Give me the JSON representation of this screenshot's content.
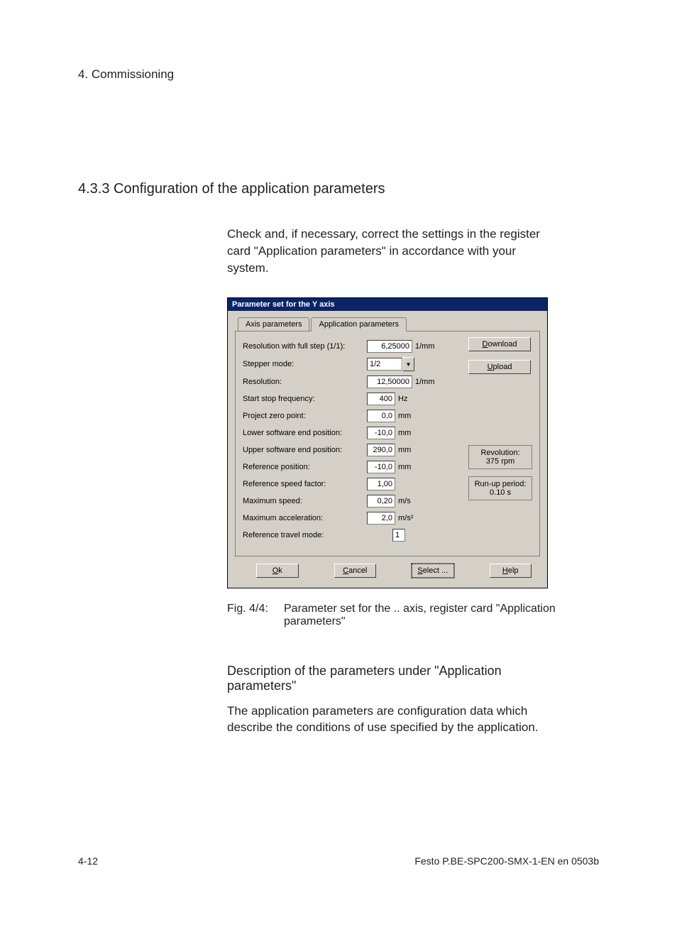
{
  "header": {
    "chapter": "4.  Commissioning"
  },
  "section_title": "4.3.3  Configuration of the application parameters",
  "intro": "Check and, if necessary, correct the settings in the register card \"Application parameters\" in accordance with your system.",
  "dialog": {
    "title": "Parameter set for the Y axis",
    "tabs": {
      "axis": "Axis parameters",
      "app": "Application parameters"
    },
    "fields": {
      "resolution_full_step": {
        "label": "Resolution with full step (1/1):",
        "value": "6,25000",
        "unit": "1/mm"
      },
      "stepper_mode": {
        "label": "Stepper mode:",
        "value": "1/2"
      },
      "resolution": {
        "label": "Resolution:",
        "value": "12,50000",
        "unit": "1/mm"
      },
      "start_stop_freq": {
        "label": "Start stop frequency:",
        "value": "400",
        "unit": "Hz"
      },
      "project_zero": {
        "label": "Project zero point:",
        "value": "0,0",
        "unit": "mm"
      },
      "lower_end": {
        "label": "Lower software end position:",
        "value": "-10,0",
        "unit": "mm"
      },
      "upper_end": {
        "label": "Upper software end position:",
        "value": "290,0",
        "unit": "mm"
      },
      "ref_position": {
        "label": "Reference position:",
        "value": "-10,0",
        "unit": "mm"
      },
      "ref_speed_factor": {
        "label": "Reference speed factor:",
        "value": "1,00",
        "unit": ""
      },
      "max_speed": {
        "label": "Maximum speed:",
        "value": "0,20",
        "unit": "m/s"
      },
      "max_accel": {
        "label": "Maximum acceleration:",
        "value": "2,0",
        "unit": "m/s²"
      },
      "ref_travel_mode": {
        "label": "Reference travel mode:",
        "value": "1"
      }
    },
    "side": {
      "download": "Download",
      "upload": "Upload",
      "revolution_label": "Revolution:",
      "revolution_value": "375 rpm",
      "runup_label": "Run-up period:",
      "runup_value": "0.10 s"
    },
    "buttons": {
      "ok": "Ok",
      "cancel": "Cancel",
      "select": "Select ...",
      "help": "Help"
    }
  },
  "caption": {
    "label": "Fig. 4/4:",
    "text": "Parameter set for the .. axis, register card \"Application parameters\""
  },
  "subheading": "Description of the parameters under \"Application parameters\"",
  "body": "The application parameters are configuration data which describe the conditions of use specified by the application.",
  "footer": {
    "page": "4-12",
    "doc": "Festo  P.BE-SPC200-SMX-1-EN  en 0503b"
  }
}
